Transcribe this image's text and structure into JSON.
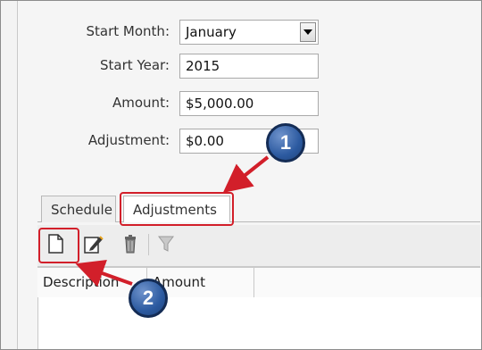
{
  "form": {
    "start_month_label": "Start Month:",
    "start_month_value": "January",
    "start_year_label": "Start Year:",
    "start_year_value": "2015",
    "amount_label": "Amount:",
    "amount_value": "$5,000.00",
    "adjustment_label": "Adjustment:",
    "adjustment_value": "$0.00"
  },
  "tabs": [
    {
      "label": "Schedule"
    },
    {
      "label": "Adjustments"
    }
  ],
  "toolbar": {
    "icons": [
      "new-document-icon",
      "edit-icon",
      "delete-icon",
      "filter-icon"
    ]
  },
  "grid": {
    "columns": [
      "Description",
      "Amount"
    ]
  },
  "callouts": {
    "one": "1",
    "two": "2",
    "accent": "#d21f2a",
    "badge_color": "#2c5aa0"
  }
}
